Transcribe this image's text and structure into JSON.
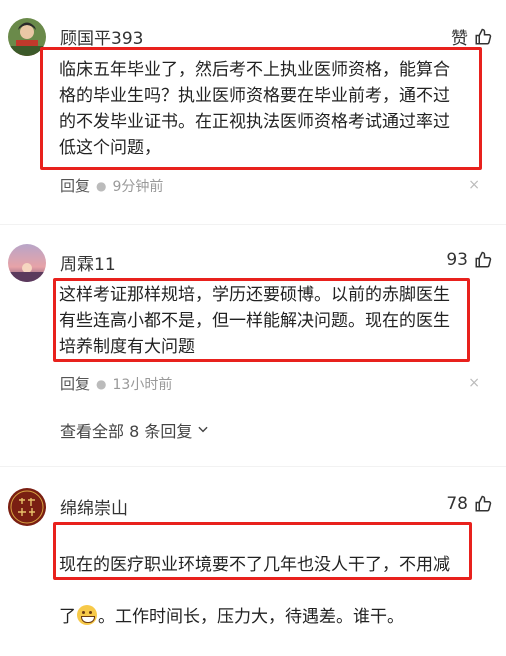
{
  "comments": [
    {
      "username": "顾国平393",
      "like_label": "赞",
      "text": "临床五年毕业了，然后考不上执业医师资格，能算合\n格的毕业生吗？执业医师资格要在毕业前考，通不过\n的不发毕业证书。在正视执法医师资格考试通过率过\n低这个问题，",
      "reply_label": "回复",
      "time": "9分钟前",
      "close": "×"
    },
    {
      "username": "周霖11",
      "like_count": "93",
      "text": "这样考证那样规培，学历还要硕博。以前的赤脚医生\n有些连高小都不是，但一样能解决问题。现在的医生\n培养制度有大问题",
      "reply_label": "回复",
      "time": "13小时前",
      "close": "×",
      "expand_label": "查看全部 8 条回复"
    },
    {
      "username": "绵绵崇山",
      "like_count": "78",
      "text_line1": "现在的医疗职业环境要不了几年也没人干了，不用减",
      "text_line2_a": "了",
      "text_line2_b": "。工作时间长，压力大，待遇差。谁干。"
    }
  ],
  "colors": {
    "highlight": "#e8211d",
    "muted": "#999999"
  },
  "icons": [
    "thumb-up-icon",
    "close-icon",
    "chevron-down-icon",
    "grin-emoji-icon"
  ]
}
